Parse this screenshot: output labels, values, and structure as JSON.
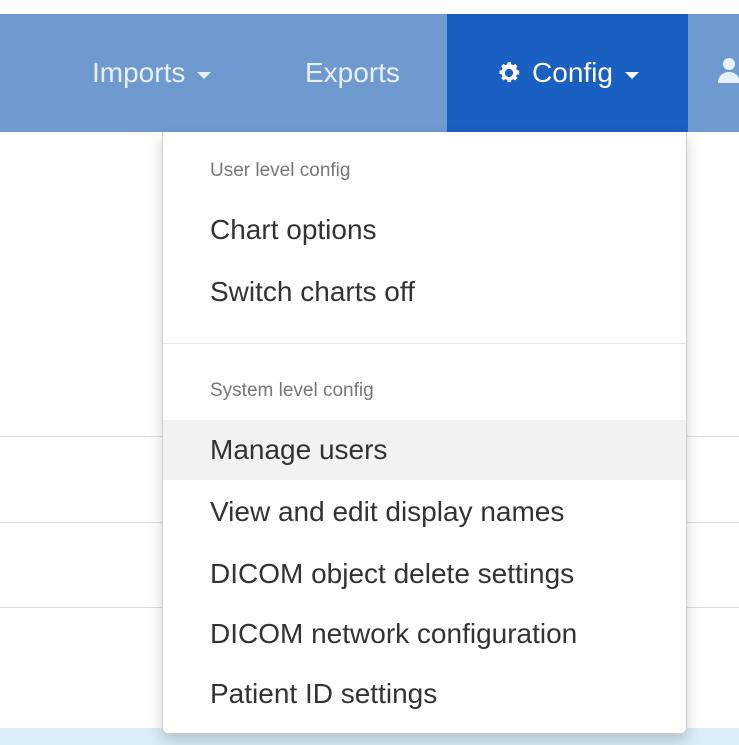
{
  "navbar": {
    "imports_label": "Imports",
    "exports_label": "Exports",
    "config_label": "Config",
    "active_color": "#1a5fc2",
    "bar_color": "#6f9ad0"
  },
  "dropdown": {
    "user_header": "User level config",
    "user_items": [
      {
        "label": "Chart options"
      },
      {
        "label": "Switch charts off"
      }
    ],
    "system_header": "System level config",
    "system_items": [
      {
        "label": "Manage users"
      },
      {
        "label": "View and edit display names"
      },
      {
        "label": "DICOM object delete settings"
      },
      {
        "label": "DICOM network configuration"
      },
      {
        "label": "Patient ID settings"
      }
    ],
    "hovered_item": "Manage users"
  },
  "icons": {
    "config": "gear-icon",
    "user": "user-icon",
    "dropdown": "caret-down-icon"
  }
}
